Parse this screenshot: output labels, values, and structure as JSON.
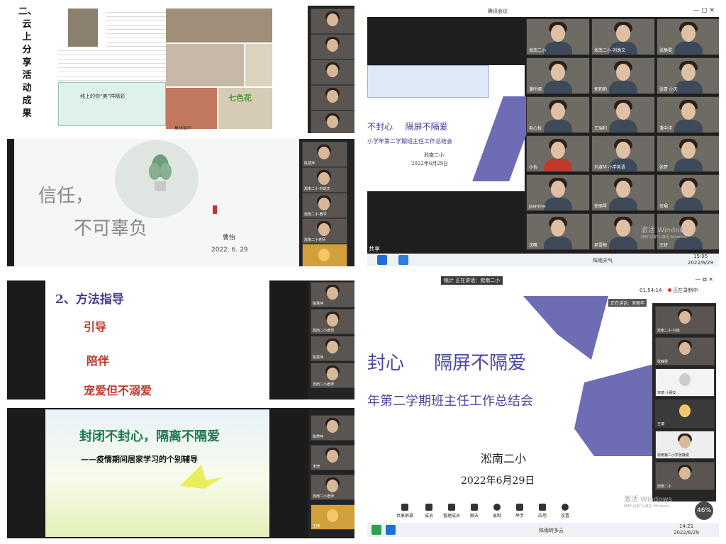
{
  "q1": {
    "vertical_title": [
      "二、",
      "云",
      "上",
      "分",
      "享",
      "活",
      "动",
      "成",
      "果"
    ],
    "doc_list": [
      "线上的你“美”样精彩",
      "七色花"
    ],
    "doc_caption": "集体展示"
  },
  "q2": {
    "title": "腾讯会议",
    "slide_title_1": "不封心",
    "slide_title_2": "隔屏不隔爱",
    "slide_subtitle": "小学年第二学期班主任工作总结会",
    "slide_school": "淞南二小",
    "slide_date": "2022年6月29日",
    "share_label": "共享",
    "watermark": "激活 Windows",
    "watermark_sub": "转到\"设置\"以激活 Windows。",
    "tray_text": "阵雨天气",
    "clock_time": "15:05",
    "clock_date": "2022/6/29",
    "participants": [
      "淞南二小",
      "淞南二小-刘逸文",
      "张静雯",
      "潘叶娜",
      "郭莉莉",
      "张青 小天",
      "毛心怡",
      "王瑞利",
      "潘中洋",
      "小怡",
      "刘淑华 小学英语",
      "张梦",
      "Jasmine",
      "徐丽琴",
      "伍珺",
      "沈曦",
      "吴雪梅",
      "王妍"
    ]
  },
  "q3": {
    "slide_title_1": "信任，",
    "slide_title_2": "不可辜负",
    "author": "曹怡",
    "date": "2022. 6. 29",
    "side_names": [
      "陈慧萍",
      "淞南二小-刘逸文",
      "淞南二小-教学",
      "淞南二小老师"
    ]
  },
  "q4": {
    "heading": "2、方法指导",
    "items": [
      "引导",
      "陪伴",
      "宠爱但不溺爱"
    ],
    "side_names": [
      "陈慧萍",
      "淞南二小老师",
      "陈慧萍",
      "淞南二小老师"
    ]
  },
  "q5": {
    "title": "封闭不封心，隔离不隔爱",
    "subtitle": "——疫情期间居家学习的个别辅导",
    "side_names": [
      "陈慧萍",
      "宋琦",
      "淞南二小老师",
      "王瑞"
    ]
  },
  "q6": {
    "window_title": "统计 正在讲话：淞南二小",
    "timer": "01:54:14",
    "record_label": "正在录制中",
    "speaking": "正在讲话：宋佩华",
    "slide_title_1": "封心",
    "slide_title_2": "隔屏不隔爱",
    "slide_subtitle": "年第二学期班主任工作总结会",
    "school": "淞南二小",
    "date": "2022年6月29日",
    "watermark": "激活 Windows",
    "watermark_sub": "转到\"设置\"以激活 Windows。",
    "badge": "46%",
    "controls": [
      "共享屏幕",
      "成员",
      "管理成员",
      "聊天",
      "录制",
      "举手",
      "应用",
      "设置"
    ],
    "tray_text": "阵雨转多云",
    "clock_time": "14:21",
    "clock_date": "2022/6/29",
    "side_names": [
      "淞南二小-刘逸",
      "张静雯",
      "宋琦 小朋友",
      "王瑞",
      "淞南第二小学张静雯",
      "淞南二小"
    ]
  }
}
